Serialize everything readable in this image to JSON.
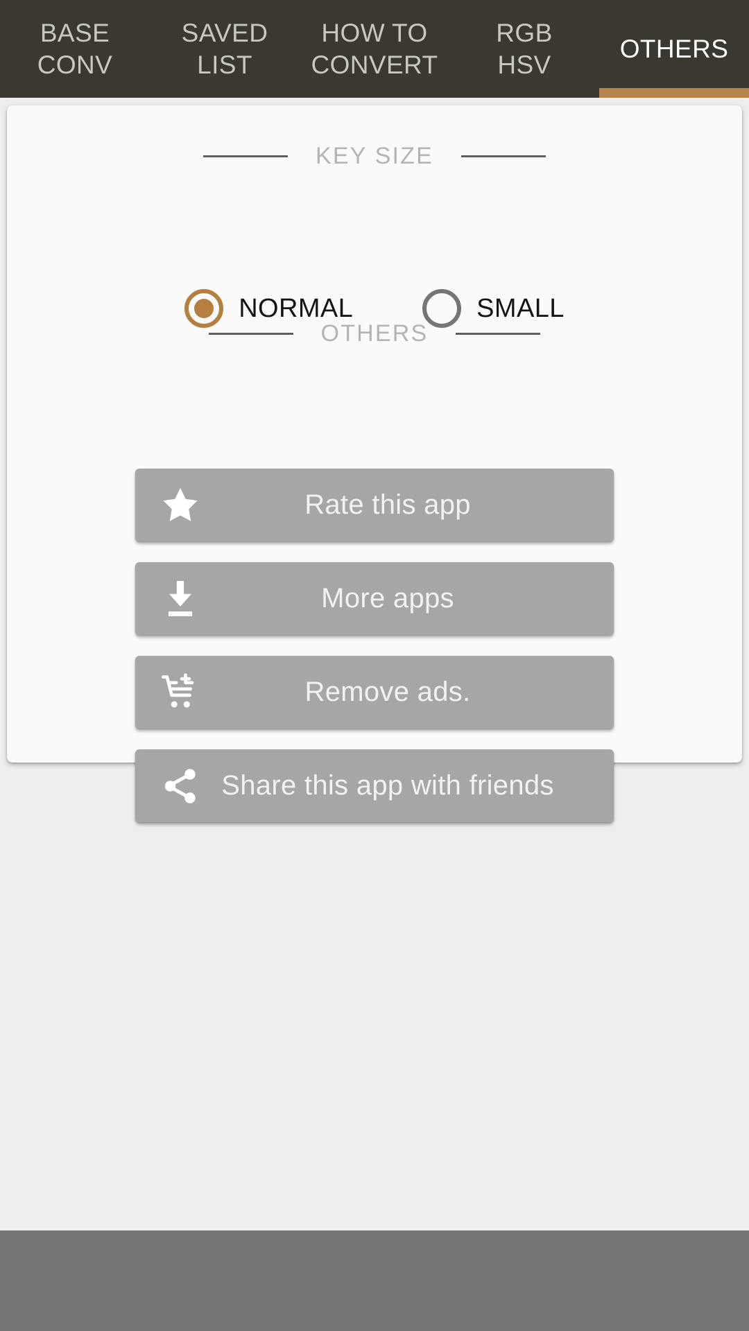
{
  "tabs": [
    {
      "label": "BASE\nCONV",
      "line1": "BASE",
      "line2": "CONV",
      "active": false
    },
    {
      "label": "SAVED\nLIST",
      "line1": "SAVED",
      "line2": "LIST",
      "active": false
    },
    {
      "label": "HOW TO\nCONVERT",
      "line1": "HOW TO",
      "line2": "CONVERT",
      "active": false
    },
    {
      "label": "RGB\nHSV",
      "line1": "RGB",
      "line2": "HSV",
      "active": false
    },
    {
      "label": "OTHERS",
      "line1": "OTHERS",
      "line2": "",
      "active": true
    }
  ],
  "sections": {
    "key_size": {
      "title": "KEY SIZE",
      "options": [
        {
          "label": "NORMAL",
          "selected": true
        },
        {
          "label": "SMALL",
          "selected": false
        }
      ]
    },
    "others": {
      "title": "OTHERS",
      "buttons": [
        {
          "label": "Rate this app",
          "icon": "star-icon"
        },
        {
          "label": "More apps",
          "icon": "download-icon"
        },
        {
          "label": "Remove ads.",
          "icon": "add-shopping-cart-icon"
        },
        {
          "label": "Share this app with friends",
          "icon": "share-icon"
        }
      ]
    }
  },
  "colors": {
    "tabbar_background": "#3b3830",
    "tab_indicator": "#b5834c",
    "tab_label": "#c9c7c2",
    "tab_label_active": "#ffffff",
    "card_background": "#fafafa",
    "page_background": "#eeeeee",
    "section_title": "#b4b4b4",
    "section_rule": "#5e5e5e",
    "radio_selected": "#b5803f",
    "radio_unselected": "#757575",
    "button_background": "#a6a6a6",
    "button_text": "#f2f2f2",
    "ad_bar": "#757575"
  }
}
